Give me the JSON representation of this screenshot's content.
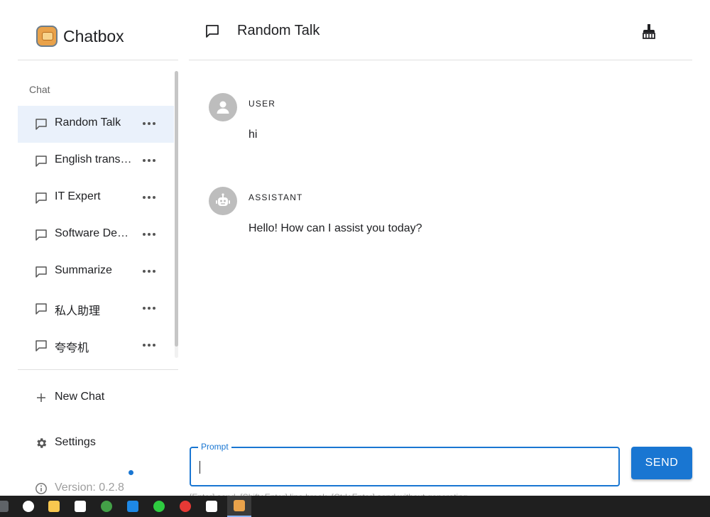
{
  "app": {
    "name": "Chatbox",
    "version_label": "Version: 0.2.8"
  },
  "sidebar": {
    "section_label": "Chat",
    "items": [
      {
        "label": "Random Talk",
        "active": true
      },
      {
        "label": "English translator",
        "active": false
      },
      {
        "label": "IT Expert",
        "active": false
      },
      {
        "label": "Software Developer",
        "active": false
      },
      {
        "label": "Summarize",
        "active": false
      },
      {
        "label": "私人助理",
        "active": false
      },
      {
        "label": "夸夸机",
        "active": false
      }
    ],
    "new_chat_label": "New Chat",
    "settings_label": "Settings"
  },
  "header": {
    "title": "Random Talk"
  },
  "messages": [
    {
      "role": "USER",
      "text": "hi"
    },
    {
      "role": "ASSISTANT",
      "text": "Hello! How can I assist you today?"
    }
  ],
  "composer": {
    "legend": "Prompt",
    "value": "",
    "send_label": "SEND",
    "hint": "[Enter] send, [Shift+Enter] line break, [Ctrl+Enter] send without generating"
  },
  "colors": {
    "accent": "#1976d2",
    "active_item_bg": "#eaf1fb",
    "taskbar_bg": "#1f1f1f"
  },
  "taskbar": {
    "apps": [
      {
        "icon": "search-app-icon",
        "color": "#5f6368"
      },
      {
        "icon": "qq-icon",
        "color": "#ffffff"
      },
      {
        "icon": "file-explorer-icon",
        "color": "#f9c74f"
      },
      {
        "icon": "capcut-icon",
        "color": "#ffffff"
      },
      {
        "icon": "green-app-icon",
        "color": "#43a047"
      },
      {
        "icon": "edge-browser-icon",
        "color": "#1e88e5"
      },
      {
        "icon": "wechat-icon",
        "color": "#2ecc40"
      },
      {
        "icon": "chrome-icon",
        "color": "#e53935"
      },
      {
        "icon": "openai-icon",
        "color": "#ffffff"
      },
      {
        "icon": "chatbox-app-icon",
        "color": "#e9a24a"
      }
    ]
  }
}
